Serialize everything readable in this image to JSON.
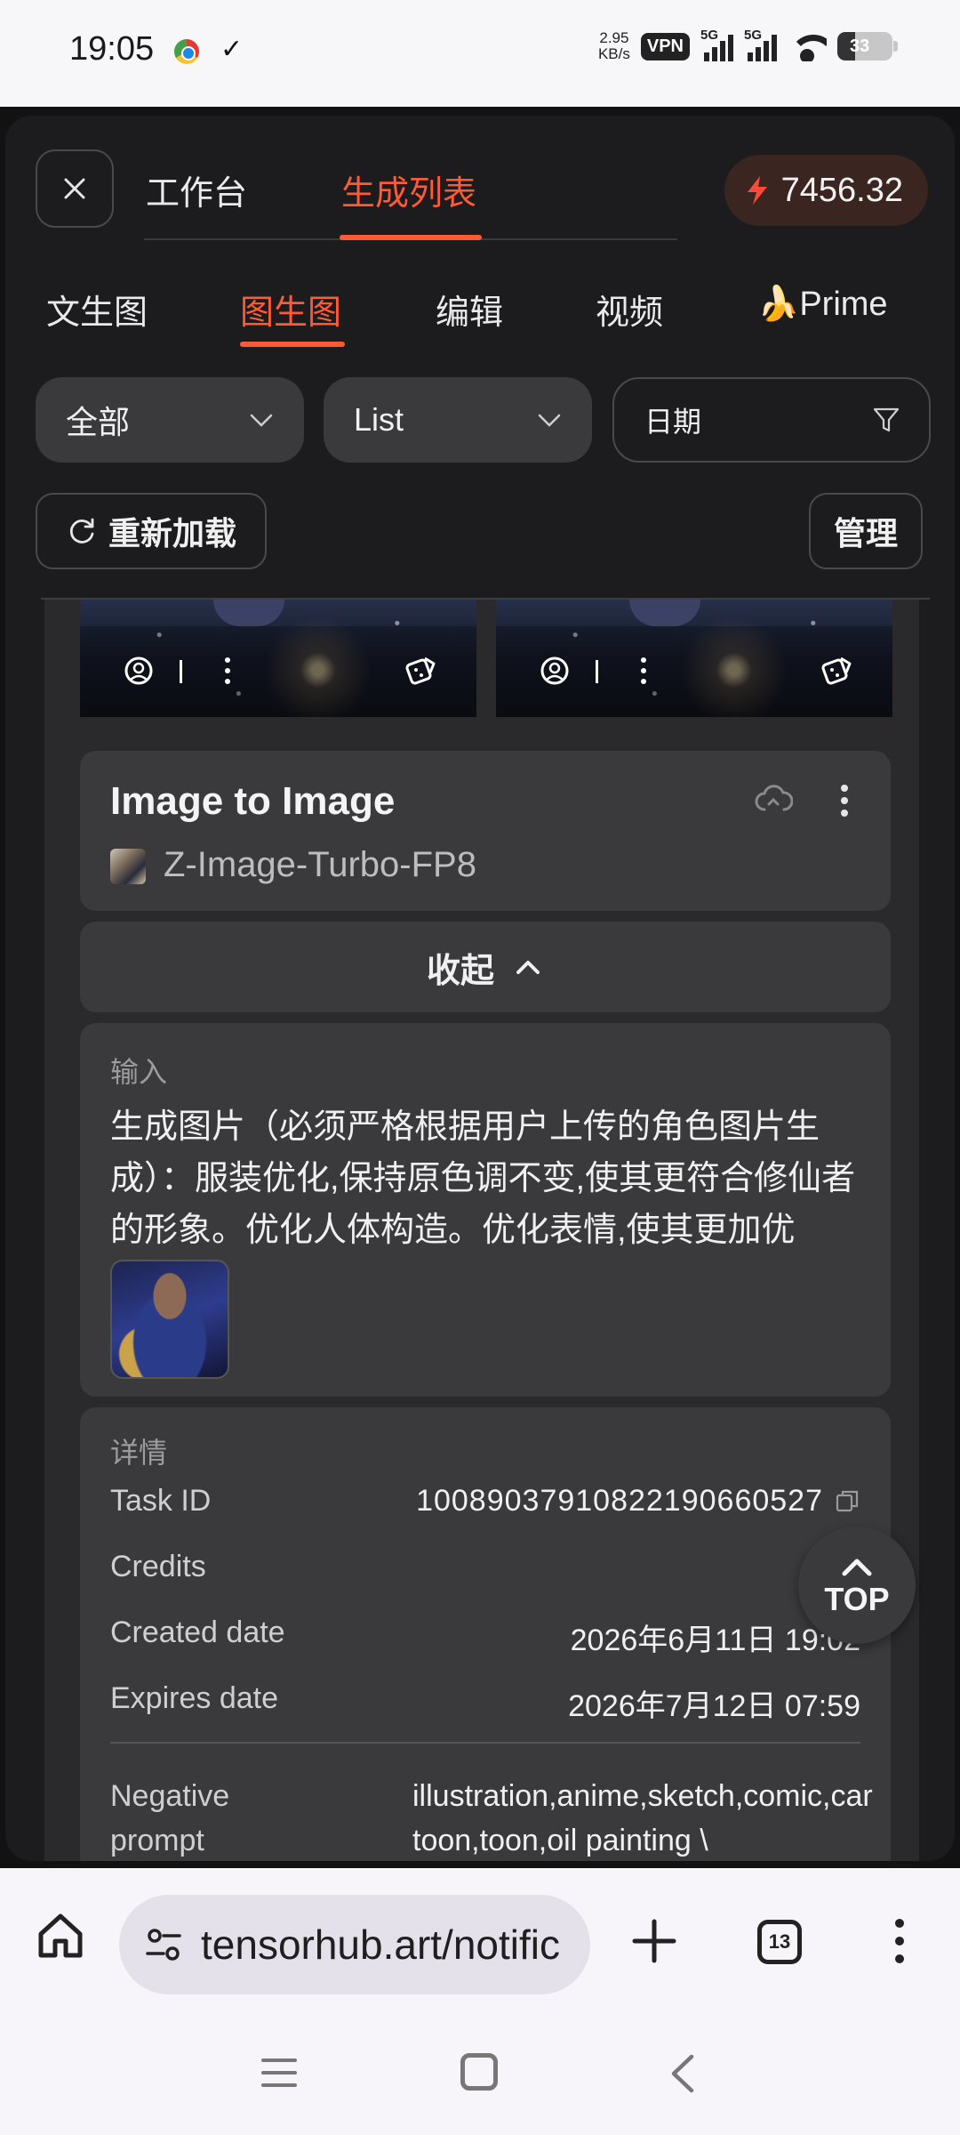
{
  "status_bar": {
    "time": "19:05",
    "network_speed_value": "2.95",
    "network_speed_unit": "KB/s",
    "vpn": "VPN",
    "sim1": "5G",
    "sim2": "5G",
    "battery": "33"
  },
  "header": {
    "tabs": [
      {
        "label": "工作台",
        "active": false
      },
      {
        "label": "生成列表",
        "active": true
      }
    ],
    "credits": "7456.32",
    "accent_color": "#ff5a36"
  },
  "sub_tabs": [
    {
      "label": "文生图",
      "active": false
    },
    {
      "label": "图生图",
      "active": true
    },
    {
      "label": "编辑",
      "active": false
    },
    {
      "label": "视频",
      "active": false
    },
    {
      "label": "🍌Prime",
      "active": false
    }
  ],
  "filters": {
    "category": "全部",
    "view": "List",
    "date_placeholder": "日期"
  },
  "actions": {
    "reload": "重新加载",
    "manage": "管理"
  },
  "task_card": {
    "title": "Image to Image",
    "model": "Z-Image-Turbo-FP8",
    "collapse_label": "收起"
  },
  "input_section": {
    "label": "输入",
    "prompt": "生成图片（必须严格根据用户上传的角色图片生成）：服装优化,保持原色调不变,使其更符合修仙者的形象。优化人体构造。优化表情,使其更加优"
  },
  "details": {
    "label": "详情",
    "task_id_label": "Task ID",
    "task_id": "1008903791082219066052​7",
    "credits_label": "Credits",
    "created_label": "Created date",
    "created": "2026年6月11日 19:02",
    "expires_label": "Expires date",
    "expires": "2026年7月12日 07:59",
    "negative_label": "Negative prompt",
    "negative": "illustration,anime,sketch,comic,cartoon,toon,oil painting \\"
  },
  "top_button": "TOP",
  "browser": {
    "url": "tensorhub.art/notific",
    "tab_count": "13"
  }
}
